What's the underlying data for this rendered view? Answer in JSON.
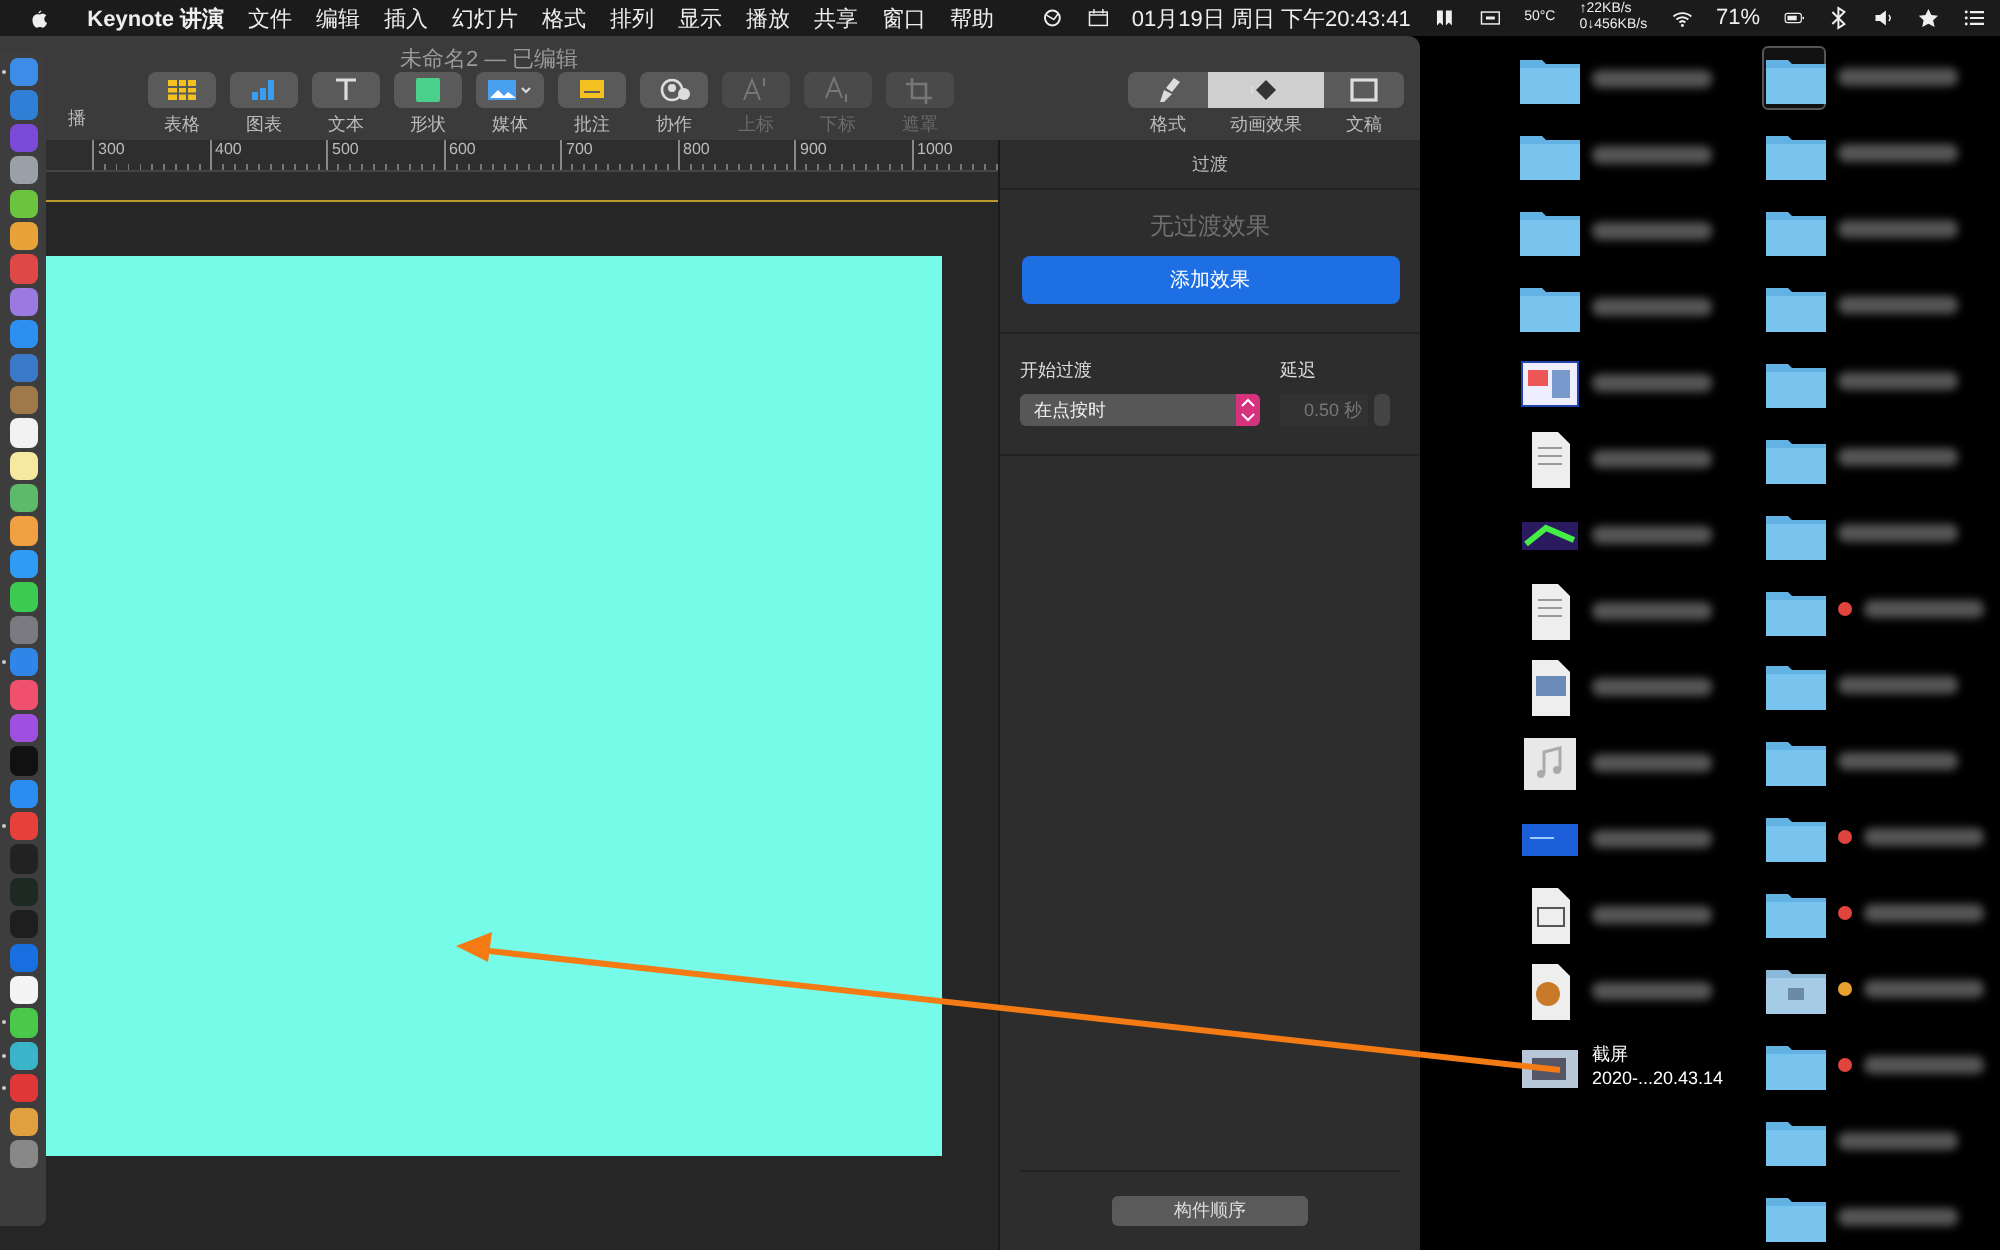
{
  "menu_bar": {
    "app_name": "Keynote 讲演",
    "items": [
      "文件",
      "编辑",
      "插入",
      "幻灯片",
      "格式",
      "排列",
      "显示",
      "播放",
      "共享",
      "窗口",
      "帮助"
    ],
    "clock": "01月19日 周日 下午20:43:41",
    "temperature": "50°C",
    "upload": "↑22KB/s",
    "download": "0↓456KB/s",
    "battery": "71%"
  },
  "dock": {
    "items": [
      {
        "color": "#3d8ee8",
        "running": true
      },
      {
        "color": "#2f7fd6",
        "running": false
      },
      {
        "color": "#7b4ad8",
        "running": false
      },
      {
        "color": "#9aa0a8",
        "running": false
      },
      {
        "color": "#6ac43d",
        "running": false
      },
      {
        "color": "#e8a23a",
        "running": false
      },
      {
        "color": "#e04848",
        "running": false
      },
      {
        "color": "#9a7ae0",
        "running": false
      },
      {
        "color": "#2d8ff0",
        "running": false
      },
      {
        "color": "#3a78c8",
        "running": false
      },
      {
        "color": "#a07a4a",
        "running": false
      },
      {
        "color": "#f2f2f2",
        "running": false
      },
      {
        "color": "#f5e9a0",
        "running": false
      },
      {
        "color": "#5cba6a",
        "running": false
      },
      {
        "color": "#f0a040",
        "running": false
      },
      {
        "color": "#2e9cf5",
        "running": false
      },
      {
        "color": "#3ccb52",
        "running": false
      },
      {
        "color": "#7a7a80",
        "running": false
      },
      {
        "color": "#2f86e8",
        "running": true
      },
      {
        "color": "#f0506e",
        "running": false
      },
      {
        "color": "#a050e0",
        "running": false
      },
      {
        "color": "#111111",
        "running": false
      },
      {
        "color": "#2c8df0",
        "running": false
      },
      {
        "color": "#e8403a",
        "running": true
      },
      {
        "color": "#222222",
        "running": false
      },
      {
        "color": "#1c2a22",
        "running": false
      },
      {
        "color": "#1e1e1e",
        "running": false
      },
      {
        "color": "#1a6fe0",
        "running": false
      },
      {
        "color": "#f4f4f4",
        "running": false
      },
      {
        "color": "#4ac84a",
        "running": true
      },
      {
        "color": "#3ab4c8",
        "running": true
      },
      {
        "color": "#e03838",
        "running": true
      },
      {
        "color": "#e0a040",
        "running": false
      },
      {
        "color": "#888888",
        "running": false
      }
    ]
  },
  "window": {
    "title": "未命名2 — 已编辑",
    "play_label": "播",
    "toolbar": [
      {
        "label": "表格",
        "kind": "table",
        "disabled": false
      },
      {
        "label": "图表",
        "kind": "chart",
        "disabled": false
      },
      {
        "label": "文本",
        "kind": "text",
        "disabled": false
      },
      {
        "label": "形状",
        "kind": "shape",
        "disabled": false
      },
      {
        "label": "媒体",
        "kind": "media",
        "disabled": false
      },
      {
        "label": "批注",
        "kind": "comment",
        "disabled": false
      },
      {
        "label": "协作",
        "kind": "collab",
        "disabled": false
      },
      {
        "label": "上标",
        "kind": "superscript",
        "disabled": true
      },
      {
        "label": "下标",
        "kind": "subscript",
        "disabled": true
      },
      {
        "label": "遮罩",
        "kind": "mask",
        "disabled": true
      }
    ],
    "inspector_tabs": [
      {
        "label": "格式",
        "kind": "format",
        "selected": false
      },
      {
        "label": "动画效果",
        "kind": "animate",
        "selected": true
      },
      {
        "label": "文稿",
        "kind": "document",
        "selected": false
      }
    ],
    "ruler": [
      "300",
      "400",
      "500",
      "600",
      "700",
      "800",
      "900",
      "1000"
    ]
  },
  "panel": {
    "header": "过渡",
    "empty_text": "无过渡效果",
    "add_button": "添加效果",
    "start_label": "开始过渡",
    "start_value": "在点按时",
    "delay_label": "延迟",
    "delay_value": "0.50 秒",
    "build_order_button": "构件顺序"
  },
  "desktop": {
    "columns": [
      [
        {
          "kind": "folder",
          "selected": false
        },
        {
          "kind": "folder",
          "selected": false
        },
        {
          "kind": "folder",
          "selected": false
        },
        {
          "kind": "folder",
          "selected": false
        },
        {
          "kind": "app-image",
          "selected": false
        },
        {
          "kind": "document",
          "selected": false
        },
        {
          "kind": "image",
          "selected": false
        },
        {
          "kind": "document",
          "selected": false
        },
        {
          "kind": "image-file",
          "selected": false
        },
        {
          "kind": "music-file",
          "selected": false
        },
        {
          "kind": "blue-file",
          "selected": false
        },
        {
          "kind": "video-file",
          "selected": false
        },
        {
          "kind": "disc-file",
          "selected": false
        },
        {
          "kind": "screenshot",
          "selected": false,
          "label": "截屏",
          "sublabel": "2020-...20.43.14"
        }
      ],
      [
        {
          "kind": "folder",
          "selected": true
        },
        {
          "kind": "folder",
          "selected": false
        },
        {
          "kind": "folder",
          "selected": false
        },
        {
          "kind": "folder",
          "selected": false
        },
        {
          "kind": "folder",
          "selected": false
        },
        {
          "kind": "folder",
          "selected": false
        },
        {
          "kind": "folder",
          "selected": false
        },
        {
          "kind": "folder",
          "selected": false,
          "color": "#e0443e"
        },
        {
          "kind": "folder",
          "selected": false
        },
        {
          "kind": "folder",
          "selected": false
        },
        {
          "kind": "folder",
          "selected": false,
          "color": "#e0443e"
        },
        {
          "kind": "folder",
          "selected": false,
          "color": "#e0443e"
        },
        {
          "kind": "light-folder",
          "selected": false,
          "color": "#e8a030"
        },
        {
          "kind": "folder",
          "selected": false,
          "color": "#e0443e"
        },
        {
          "kind": "folder",
          "selected": false
        },
        {
          "kind": "folder",
          "selected": false
        }
      ]
    ]
  }
}
